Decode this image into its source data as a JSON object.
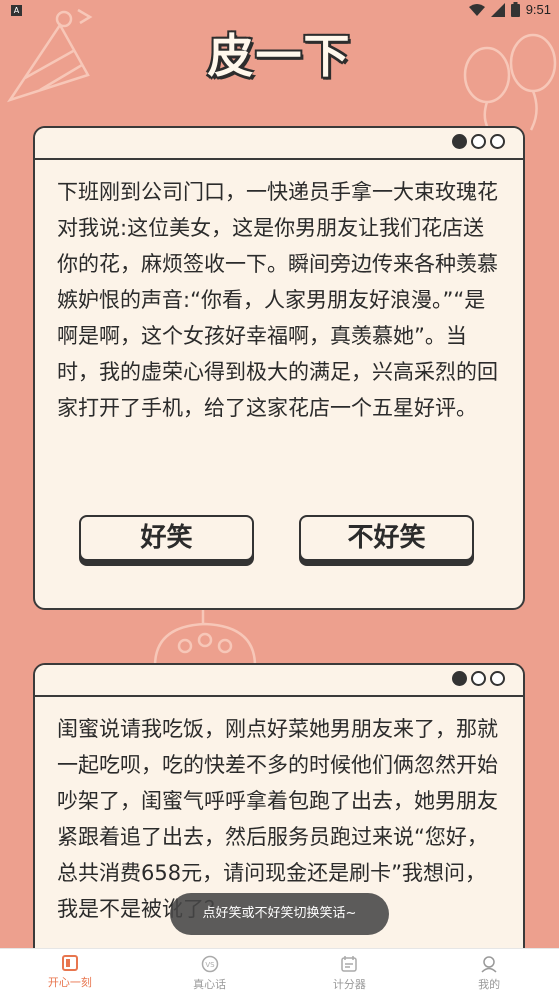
{
  "status_bar": {
    "time": "9:51",
    "badge": "A"
  },
  "header": {
    "title": "皮一下"
  },
  "cards": [
    {
      "text": "下班刚到公司门口，一快递员手拿一大束玫瑰花对我说:这位美女，这是你男朋友让我们花店送你的花，麻烦签收一下。瞬间旁边传来各种羡慕嫉妒恨的声音:“你看，人家男朋友好浪漫。”“是啊是啊，这个女孩好幸福啊，真羡慕她”。当时，我的虚荣心得到极大的满足，兴高采烈的回家打开了手机，给了这家花店一个五星好评。",
      "buttons": {
        "funny": "好笑",
        "not_funny": "不好笑"
      }
    },
    {
      "text": "闺蜜说请我吃饭，刚点好菜她男朋友来了，那就一起吃呗，吃的快差不多的时候他们俩忽然开始吵架了，闺蜜气呼呼拿着包跑了出去，她男朋友紧跟着追了出去，然后服务员跑过来说“您好，总共消费658元，请问现金还是刷卡”我想问，我是不是被讹了？"
    }
  ],
  "toast": "点好笑或不好笑切换笑话~",
  "tabs": [
    {
      "label": "开心一刻",
      "icon": "book-icon",
      "active": true
    },
    {
      "label": "真心话",
      "icon": "vs-icon",
      "active": false
    },
    {
      "label": "计分器",
      "icon": "calendar-icon",
      "active": false
    },
    {
      "label": "我的",
      "icon": "avatar-icon",
      "active": false
    }
  ],
  "colors": {
    "background": "#eda08e",
    "card": "#fcf3e8",
    "accent": "#e8764f",
    "outline": "#333333"
  }
}
